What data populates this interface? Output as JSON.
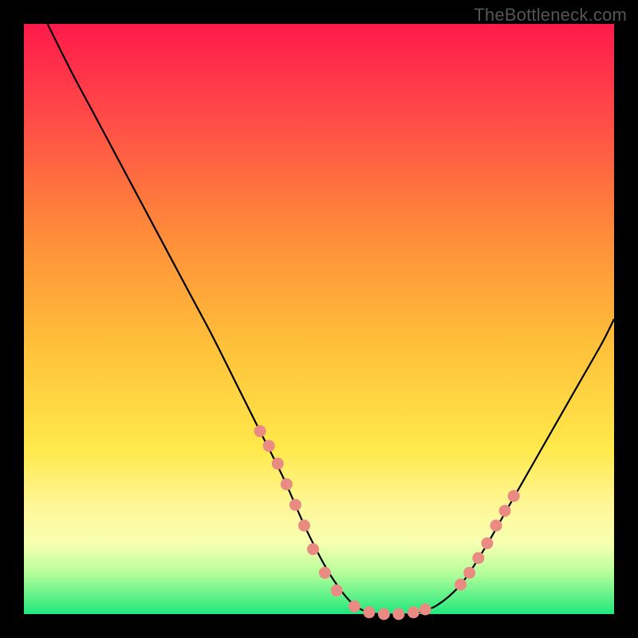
{
  "watermark": "TheBottleneck.com",
  "chart_data": {
    "type": "line",
    "title": "",
    "xlabel": "",
    "ylabel": "",
    "xlim": [
      0,
      100
    ],
    "ylim": [
      0,
      100
    ],
    "grid": false,
    "legend": false,
    "background_gradient": {
      "stops": [
        {
          "offset": 0.0,
          "color": "#ff1a4b"
        },
        {
          "offset": 0.15,
          "color": "#ff4848"
        },
        {
          "offset": 0.35,
          "color": "#ff8a3a"
        },
        {
          "offset": 0.55,
          "color": "#ffc23a"
        },
        {
          "offset": 0.72,
          "color": "#ffe94b"
        },
        {
          "offset": 0.82,
          "color": "#fff79a"
        },
        {
          "offset": 0.88,
          "color": "#f7ffb0"
        },
        {
          "offset": 0.93,
          "color": "#b6ff9b"
        },
        {
          "offset": 1.0,
          "color": "#1fe87c"
        }
      ]
    },
    "series": [
      {
        "name": "curve",
        "color": "#000000",
        "x": [
          4,
          8,
          12,
          16,
          20,
          24,
          28,
          32,
          36,
          40,
          44,
          48,
          52,
          56,
          60,
          64,
          66,
          70,
          74,
          78,
          82,
          86,
          90,
          94,
          98,
          100
        ],
        "y": [
          100,
          92,
          84.5,
          77,
          69.5,
          62,
          54.5,
          47,
          39,
          31,
          23,
          14,
          6.5,
          1.5,
          0,
          0,
          0,
          1.5,
          5,
          11,
          18,
          25,
          32,
          39,
          46,
          50
        ]
      }
    ],
    "scatter_overlay": {
      "name": "highlighted-points",
      "color": "#e98b82",
      "points": [
        {
          "x": 40,
          "y": 31
        },
        {
          "x": 41.5,
          "y": 28.5
        },
        {
          "x": 43,
          "y": 25.5
        },
        {
          "x": 44.5,
          "y": 22
        },
        {
          "x": 46,
          "y": 18.5
        },
        {
          "x": 47.5,
          "y": 15
        },
        {
          "x": 49,
          "y": 11
        },
        {
          "x": 51,
          "y": 7
        },
        {
          "x": 53,
          "y": 4
        },
        {
          "x": 56,
          "y": 1.3
        },
        {
          "x": 58.5,
          "y": 0.3
        },
        {
          "x": 61,
          "y": 0
        },
        {
          "x": 63.5,
          "y": 0
        },
        {
          "x": 66,
          "y": 0.3
        },
        {
          "x": 68,
          "y": 0.8
        },
        {
          "x": 74,
          "y": 5
        },
        {
          "x": 75.5,
          "y": 7
        },
        {
          "x": 77,
          "y": 9.5
        },
        {
          "x": 78.5,
          "y": 12
        },
        {
          "x": 80,
          "y": 15
        },
        {
          "x": 81.5,
          "y": 17.5
        },
        {
          "x": 83,
          "y": 20
        }
      ]
    }
  }
}
